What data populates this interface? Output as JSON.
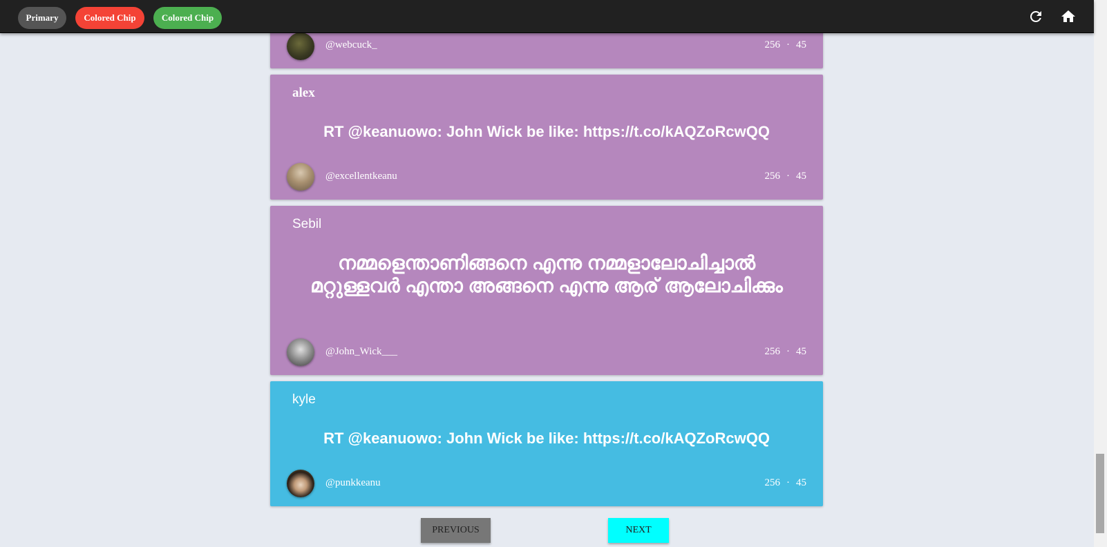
{
  "topbar": {
    "chips": [
      "Primary",
      "Colored Chip",
      "Colored Chip"
    ],
    "icons": [
      "refresh-icon",
      "home-icon"
    ]
  },
  "cards": [
    {
      "user": "",
      "text": "",
      "handle": "@webcuck_",
      "stat1": "256",
      "stat2": "45",
      "color": "#b587bd"
    },
    {
      "user": "alex",
      "text": "RT @keanuowo: John Wick be like: https://t.co/kAQZoRcwQQ",
      "handle": "@excellentkeanu",
      "stat1": "256",
      "stat2": "45",
      "color": "#b587bd"
    },
    {
      "user": "Sebil",
      "text": "നമ്മളെന്താണിങ്ങനെ എന്നു നമ്മളാലോചിച്ചാൽ മറ്റുള്ളവർ എന്താ അങ്ങനെ എന്നു ആര് ആലോചിക്കും",
      "handle": "@John_Wick___",
      "stat1": "256",
      "stat2": "45",
      "color": "#b587bd"
    },
    {
      "user": "kyle",
      "text": "RT @keanuowo: John Wick be like: https://t.co/kAQZoRcwQQ",
      "handle": "@punkkeanu",
      "stat1": "256",
      "stat2": "45",
      "color": "#45bce2"
    }
  ],
  "stat_separator": "·",
  "pagination": {
    "previous": "PREVIOUS",
    "next": "NEXT"
  }
}
